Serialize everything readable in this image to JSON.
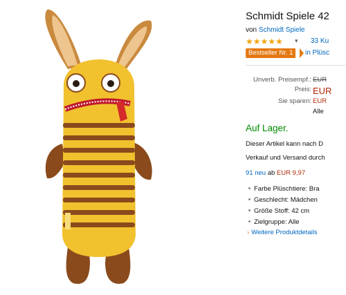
{
  "product": {
    "title": "Schmidt Spiele 42",
    "brand_prefix": "von",
    "brand": "Schmidt Spiele",
    "stars": "★★★★★",
    "rating_count": "33 Ku",
    "bestseller_badge": "Bestseller Nr. 1",
    "bestseller_category": "in Plüsc"
  },
  "pricing": {
    "list_label": "Unverb. Preisempf.:",
    "list_value": "EUR",
    "price_label": "Preis:",
    "price_value": "EUR",
    "save_label": "Sie sparen:",
    "save_value": "EUR",
    "tax_note": "Alle"
  },
  "availability": {
    "status": "Auf Lager.",
    "info_line1": "Dieser Artikel kann nach D",
    "info_line2": "Verkauf und Versand durch"
  },
  "offers": {
    "count": "91 neu",
    "from": "ab",
    "price": "EUR 9,97"
  },
  "details": {
    "items": [
      "Farbe Plüschtiere: Bra",
      "Geschlecht: Mädchen",
      "Größe Stoff: 42 cm",
      "Zielgruppe: Alle"
    ],
    "more_link": "Weitere Produktdetails"
  },
  "colors": {
    "link": "#0066c0",
    "badge": "#e47911",
    "price_red": "#b12704",
    "in_stock_green": "#008a00",
    "star": "#f0a30a"
  },
  "icons": [
    "dropdown-caret-icon",
    "chevron-right-icon",
    "bullet-icon"
  ]
}
